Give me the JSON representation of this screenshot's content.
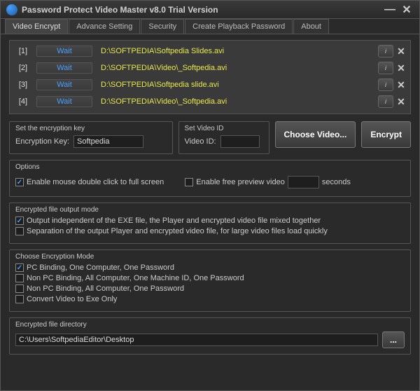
{
  "window": {
    "title": "Password Protect Video Master v8.0 Trial Version"
  },
  "tabs": [
    {
      "label": "Video Encrypt"
    },
    {
      "label": "Advance Setting"
    },
    {
      "label": "Security"
    },
    {
      "label": "Create Playback Password"
    },
    {
      "label": "About"
    }
  ],
  "files": [
    {
      "idx": "[1]",
      "status": "Wait",
      "path": "D:\\SOFTPEDIA\\Softpedia Slides.avi"
    },
    {
      "idx": "[2]",
      "status": "Wait",
      "path": "D:\\SOFTPEDIA\\Video\\_Softpedia.avi"
    },
    {
      "idx": "[3]",
      "status": "Wait",
      "path": "D:\\SOFTPEDIA\\Softpedia slide.avi"
    },
    {
      "idx": "[4]",
      "status": "Wait",
      "path": "D:\\SOFTPEDIA\\Video\\_Softpedia.avi"
    }
  ],
  "encKey": {
    "section": "Set the encryption key",
    "label": "Encryption Key:",
    "value": "Softpedia"
  },
  "videoId": {
    "section": "Set Video ID",
    "label": "Video ID:",
    "value": ""
  },
  "buttons": {
    "choose": "Choose Video...",
    "encrypt": "Encrypt",
    "browse": "..."
  },
  "options": {
    "section": "Options",
    "fullscreen": "Enable mouse double click to full screen",
    "preview": "Enable free preview video",
    "previewUnit": "seconds",
    "previewValue": ""
  },
  "outputMode": {
    "section": "Encrypted file output mode",
    "opt1": "Output independent of the EXE file, the Player and encrypted video file mixed together",
    "opt2": "Separation of the output Player and encrypted video file, for large video files load quickly"
  },
  "encMode": {
    "section": "Choose Encryption Mode",
    "opt1": "PC Binding, One Computer, One Password",
    "opt2": "Non PC Binding, All Computer, One Machine ID, One Password",
    "opt3": "Non PC Binding, All Computer, One Password",
    "opt4": "Convert Video to Exe Only"
  },
  "outputDir": {
    "section": "Encrypted file directory",
    "value": "C:\\Users\\SoftpediaEditor\\Desktop"
  }
}
